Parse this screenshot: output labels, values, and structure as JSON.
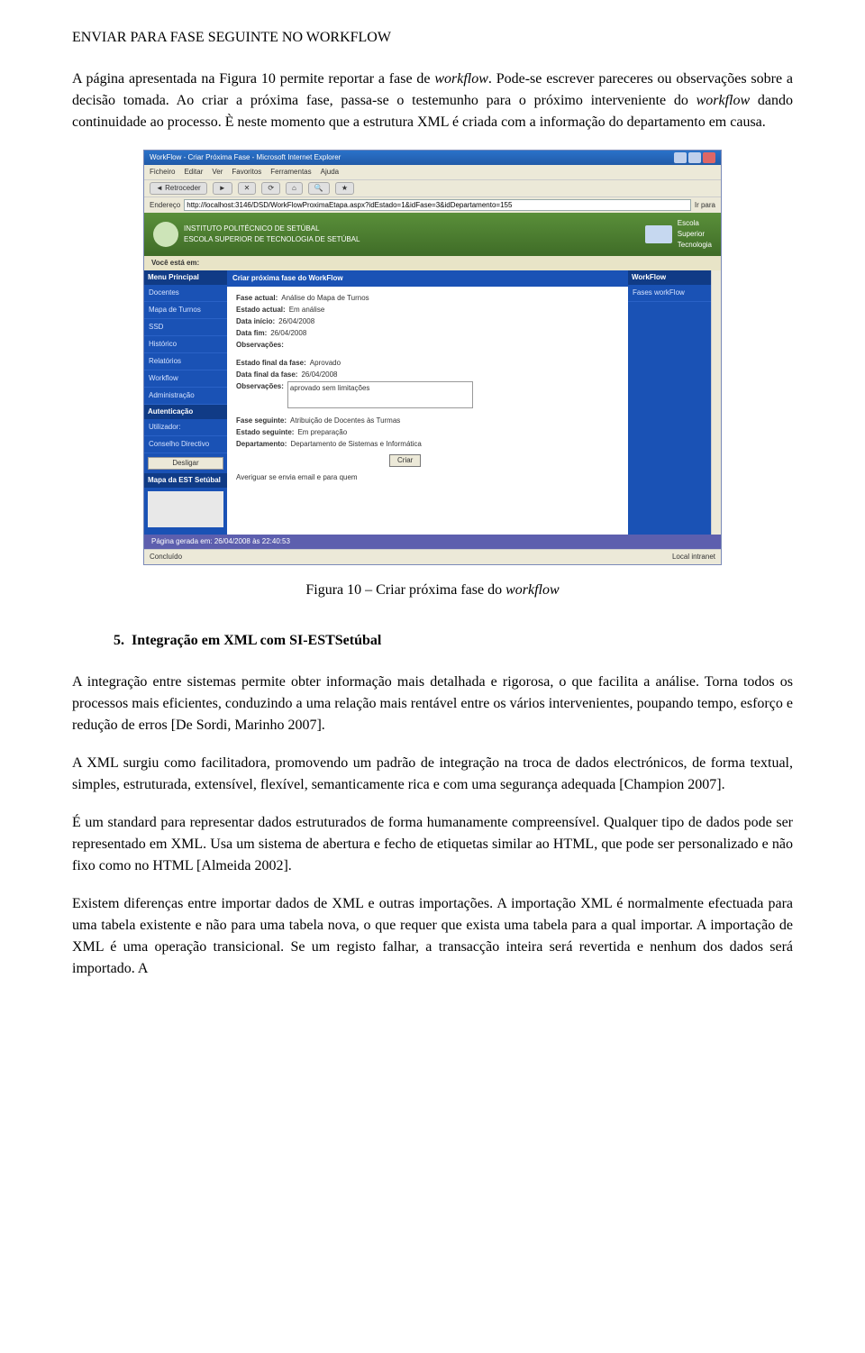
{
  "header": "ENVIAR PARA FASE SEGUINTE NO WORKFLOW",
  "p1_a": "A página apresentada na Figura 10 permite reportar a fase de ",
  "p1_i": "workflow",
  "p1_b": ". Pode-se escrever pareceres ou observações sobre a decisão tomada. Ao criar a próxima fase, passa-se o testemunho para o próximo interveniente do ",
  "p1_i2": "workflow",
  "p1_c": " dando continuidade ao processo. È neste momento que a estrutura XML é criada com a informação do departamento em causa.",
  "caption_a": "Figura 10 – Criar próxima fase do ",
  "caption_i": "workflow",
  "heading_num": "5.",
  "heading_txt": "Integração em XML com SI-ESTSetúbal",
  "p2": "A integração entre sistemas permite obter informação mais detalhada e rigorosa, o que facilita a análise. Torna todos os processos mais eficientes, conduzindo a uma relação mais rentável entre os vários intervenientes, poupando tempo, esforço e redução de erros [De Sordi, Marinho 2007].",
  "p3": "A XML surgiu como facilitadora, promovendo um padrão de integração na troca de dados electrónicos, de forma textual, simples, estruturada, extensível, flexível, semanticamente rica e com uma segurança adequada [Champion 2007].",
  "p4": "É um standard para representar dados estruturados de forma humanamente compreensível. Qualquer tipo de dados pode ser representado em XML. Usa um sistema de abertura e fecho de etiquetas similar ao HTML, que pode ser personalizado e não fixo como no HTML [Almeida 2002].",
  "p5": "Existem diferenças entre importar dados de XML e outras importações. A importação XML é normalmente efectuada para uma tabela existente e não para uma tabela nova, o que requer que exista uma tabela para a qual importar. A importação de XML é uma operação transicional. Se um registo falhar, a transacção inteira será revertida e nenhum dos dados será importado. A",
  "ss": {
    "title": "WorkFlow - Criar Próxima Fase - Microsoft Internet Explorer",
    "menu": [
      "Ficheiro",
      "Editar",
      "Ver",
      "Favoritos",
      "Ferramentas",
      "Ajuda"
    ],
    "back": "Retroceder",
    "addr_label": "Endereço",
    "url": "http://localhost:3146/DSD/WorkFlowProximaEtapa.aspx?idEstado=1&idFase=3&idDepartamento=155",
    "go": "Ir para",
    "banner_inst": "INSTITUTO POLITÉCNICO DE SETÚBAL",
    "banner_school": "ESCOLA SUPERIOR DE TECNOLOGIA DE SETÚBAL",
    "banner_right1": "Escola",
    "banner_right2": "Superior",
    "banner_right3": "Tecnologia",
    "you": "Você está em:",
    "left_head": "Menu Principal",
    "left_items": [
      "Docentes",
      "Mapa de Turnos",
      "SSD",
      "Histórico",
      "Relatórios",
      "Workflow",
      "Administração"
    ],
    "left_sub1": "Autenticação",
    "left_sub2": "Utilizador:",
    "left_sub3": "Conselho Directivo",
    "left_btn": "Desligar",
    "left_map": "Mapa da EST Setúbal",
    "main_head": "Criar próxima fase do WorkFlow",
    "rows": {
      "fase_actual": [
        "Fase actual:",
        "Análise do Mapa de Turnos"
      ],
      "estado_actual": [
        "Estado actual:",
        "Em análise"
      ],
      "data_inicio": [
        "Data início:",
        "26/04/2008"
      ],
      "data_fim": [
        "Data fim:",
        "26/04/2008"
      ],
      "obs1": "Observações:",
      "estado_final": [
        "Estado final da fase:",
        "Aprovado"
      ],
      "data_final": [
        "Data final da fase:",
        "26/04/2008"
      ],
      "obs2_label": "Observações:",
      "obs2_val": "aprovado sem limitações",
      "fase_seguinte": [
        "Fase seguinte:",
        "Atribuição de Docentes às Turmas"
      ],
      "estado_seguinte": [
        "Estado seguinte:",
        "Em preparação"
      ],
      "departamento": [
        "Departamento:",
        "Departamento de Sistemas e Informática"
      ]
    },
    "criar": "Criar",
    "note": "Averiguar se envia email e para quem",
    "right_head": "WorkFlow",
    "right_item": "Fases workFlow",
    "footer_time": "Página gerada em: 26/04/2008 às 22:40:53",
    "status_left": "Concluído",
    "status_right": "Local intranet"
  }
}
